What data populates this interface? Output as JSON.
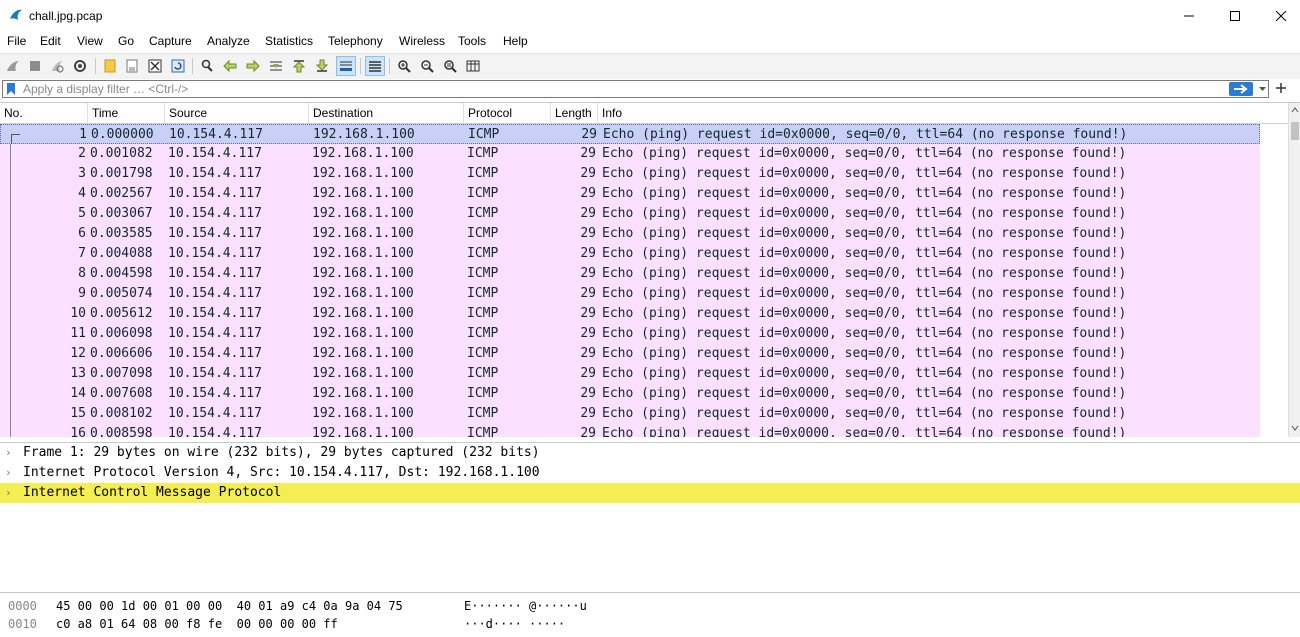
{
  "window": {
    "title": "chall.jpg.pcap"
  },
  "menu": [
    "File",
    "Edit",
    "View",
    "Go",
    "Capture",
    "Analyze",
    "Statistics",
    "Telephony",
    "Wireless",
    "Tools",
    "Help"
  ],
  "filter": {
    "placeholder": "Apply a display filter … <Ctrl-/>",
    "value": ""
  },
  "columns": {
    "no": "No.",
    "time": "Time",
    "source": "Source",
    "destination": "Destination",
    "protocol": "Protocol",
    "length": "Length",
    "info": "Info"
  },
  "packets": [
    {
      "no": "1",
      "time": "0.000000",
      "src": "10.154.4.117",
      "dst": "192.168.1.100",
      "proto": "ICMP",
      "len": "29",
      "info": "Echo (ping) request  id=0x0000, seq=0/0, ttl=64 (no response found!)"
    },
    {
      "no": "2",
      "time": "0.001082",
      "src": "10.154.4.117",
      "dst": "192.168.1.100",
      "proto": "ICMP",
      "len": "29",
      "info": "Echo (ping) request  id=0x0000, seq=0/0, ttl=64 (no response found!)"
    },
    {
      "no": "3",
      "time": "0.001798",
      "src": "10.154.4.117",
      "dst": "192.168.1.100",
      "proto": "ICMP",
      "len": "29",
      "info": "Echo (ping) request  id=0x0000, seq=0/0, ttl=64 (no response found!)"
    },
    {
      "no": "4",
      "time": "0.002567",
      "src": "10.154.4.117",
      "dst": "192.168.1.100",
      "proto": "ICMP",
      "len": "29",
      "info": "Echo (ping) request  id=0x0000, seq=0/0, ttl=64 (no response found!)"
    },
    {
      "no": "5",
      "time": "0.003067",
      "src": "10.154.4.117",
      "dst": "192.168.1.100",
      "proto": "ICMP",
      "len": "29",
      "info": "Echo (ping) request  id=0x0000, seq=0/0, ttl=64 (no response found!)"
    },
    {
      "no": "6",
      "time": "0.003585",
      "src": "10.154.4.117",
      "dst": "192.168.1.100",
      "proto": "ICMP",
      "len": "29",
      "info": "Echo (ping) request  id=0x0000, seq=0/0, ttl=64 (no response found!)"
    },
    {
      "no": "7",
      "time": "0.004088",
      "src": "10.154.4.117",
      "dst": "192.168.1.100",
      "proto": "ICMP",
      "len": "29",
      "info": "Echo (ping) request  id=0x0000, seq=0/0, ttl=64 (no response found!)"
    },
    {
      "no": "8",
      "time": "0.004598",
      "src": "10.154.4.117",
      "dst": "192.168.1.100",
      "proto": "ICMP",
      "len": "29",
      "info": "Echo (ping) request  id=0x0000, seq=0/0, ttl=64 (no response found!)"
    },
    {
      "no": "9",
      "time": "0.005074",
      "src": "10.154.4.117",
      "dst": "192.168.1.100",
      "proto": "ICMP",
      "len": "29",
      "info": "Echo (ping) request  id=0x0000, seq=0/0, ttl=64 (no response found!)"
    },
    {
      "no": "10",
      "time": "0.005612",
      "src": "10.154.4.117",
      "dst": "192.168.1.100",
      "proto": "ICMP",
      "len": "29",
      "info": "Echo (ping) request  id=0x0000, seq=0/0, ttl=64 (no response found!)"
    },
    {
      "no": "11",
      "time": "0.006098",
      "src": "10.154.4.117",
      "dst": "192.168.1.100",
      "proto": "ICMP",
      "len": "29",
      "info": "Echo (ping) request  id=0x0000, seq=0/0, ttl=64 (no response found!)"
    },
    {
      "no": "12",
      "time": "0.006606",
      "src": "10.154.4.117",
      "dst": "192.168.1.100",
      "proto": "ICMP",
      "len": "29",
      "info": "Echo (ping) request  id=0x0000, seq=0/0, ttl=64 (no response found!)"
    },
    {
      "no": "13",
      "time": "0.007098",
      "src": "10.154.4.117",
      "dst": "192.168.1.100",
      "proto": "ICMP",
      "len": "29",
      "info": "Echo (ping) request  id=0x0000, seq=0/0, ttl=64 (no response found!)"
    },
    {
      "no": "14",
      "time": "0.007608",
      "src": "10.154.4.117",
      "dst": "192.168.1.100",
      "proto": "ICMP",
      "len": "29",
      "info": "Echo (ping) request  id=0x0000, seq=0/0, ttl=64 (no response found!)"
    },
    {
      "no": "15",
      "time": "0.008102",
      "src": "10.154.4.117",
      "dst": "192.168.1.100",
      "proto": "ICMP",
      "len": "29",
      "info": "Echo (ping) request  id=0x0000, seq=0/0, ttl=64 (no response found!)"
    },
    {
      "no": "16",
      "time": "0.008598",
      "src": "10.154.4.117",
      "dst": "192.168.1.100",
      "proto": "ICMP",
      "len": "29",
      "info": "Echo (ping) request  id=0x0000, seq=0/0, ttl=64 (no response found!)"
    }
  ],
  "details": [
    {
      "text": "Frame 1: 29 bytes on wire (232 bits), 29 bytes captured (232 bits)",
      "highlight": false
    },
    {
      "text": "Internet Protocol Version 4, Src: 10.154.4.117, Dst: 192.168.1.100",
      "highlight": false
    },
    {
      "text": "Internet Control Message Protocol",
      "highlight": true
    }
  ],
  "bytes": [
    {
      "offset": "0000",
      "hex": "45 00 00 1d 00 01 00 00  40 01 a9 c4 0a 9a 04 75",
      "ascii": "E······· @······u"
    },
    {
      "offset": "0010",
      "hex": "c0 a8 01 64 08 00 f8 fe  00 00 00 00 ff",
      "ascii": "···d···· ·····"
    }
  ],
  "colors": {
    "row_bg": "#fce0ff",
    "selected_bg": "#c9d0f7",
    "highlight": "#f4ee52",
    "accent": "#2a7bd6"
  }
}
